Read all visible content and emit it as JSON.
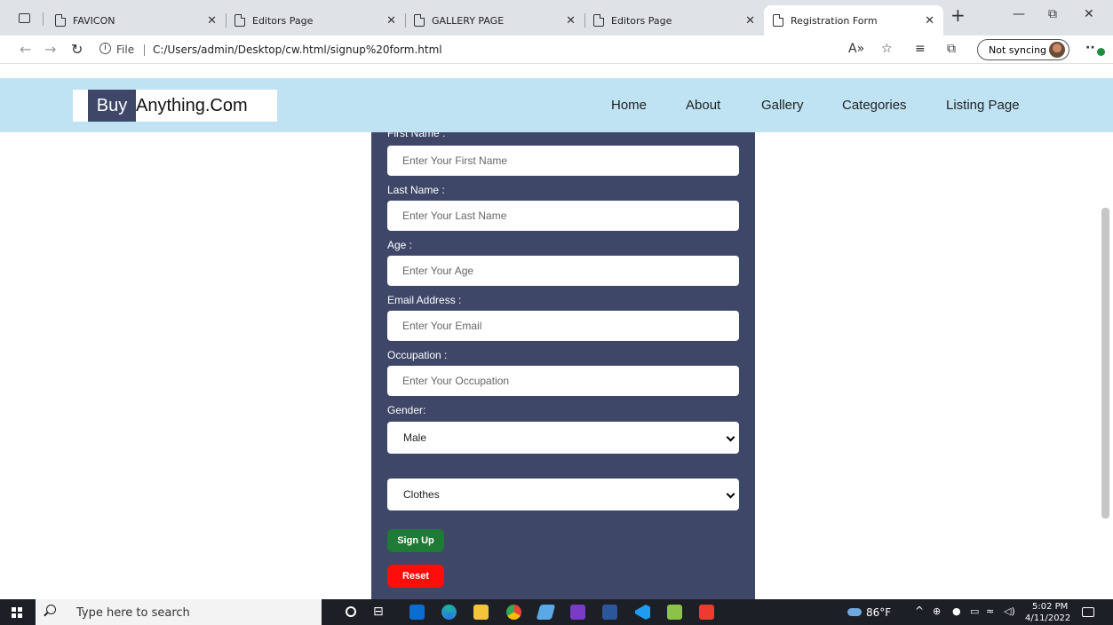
{
  "browser": {
    "tabs": [
      {
        "title": "FAVICON",
        "icon": "page-icon"
      },
      {
        "title": "Editors Page",
        "icon": "page-icon"
      },
      {
        "title": "GALLERY PAGE",
        "icon": "page-icon"
      },
      {
        "title": "Editors Page",
        "icon": "page-icon"
      },
      {
        "title": "Registration Form",
        "icon": "page-icon",
        "active": true
      }
    ],
    "new_tab": "+",
    "window_controls": {
      "minimize": "—",
      "restore": "⧉",
      "close": "✕"
    },
    "address": {
      "prefix": "File",
      "url": "C:/Users/admin/Desktop/cw.html/signup%20form.html"
    },
    "profile": {
      "label": "Not syncing"
    }
  },
  "site": {
    "logo": {
      "part1": "Buy",
      "part2": "Anything.Com"
    },
    "nav": [
      "Home",
      "About",
      "Gallery",
      "Categories",
      "Listing Page"
    ]
  },
  "form": {
    "first_name": {
      "label": "First Name :",
      "placeholder": "Enter Your First Name"
    },
    "last_name": {
      "label": "Last Name :",
      "placeholder": "Enter Your Last Name"
    },
    "age": {
      "label": "Age :",
      "placeholder": "Enter Your Age"
    },
    "email": {
      "label": "Email Address :",
      "placeholder": "Enter Your Email"
    },
    "occupation": {
      "label": "Occupation :",
      "placeholder": "Enter Your Occupation"
    },
    "gender": {
      "label": "Gender:",
      "value": "Male"
    },
    "category": {
      "value": "Clothes"
    },
    "signup_label": "Sign Up",
    "reset_label": "Reset"
  },
  "taskbar": {
    "search_placeholder": "Type here to search",
    "weather": "86°F",
    "time": "5:02 PM",
    "date": "4/11/2022"
  },
  "colors": {
    "navbar": "#bfe3f3",
    "form_panel": "#3e4768",
    "signup": "#1f7a35",
    "reset": "#ff0d0d"
  }
}
